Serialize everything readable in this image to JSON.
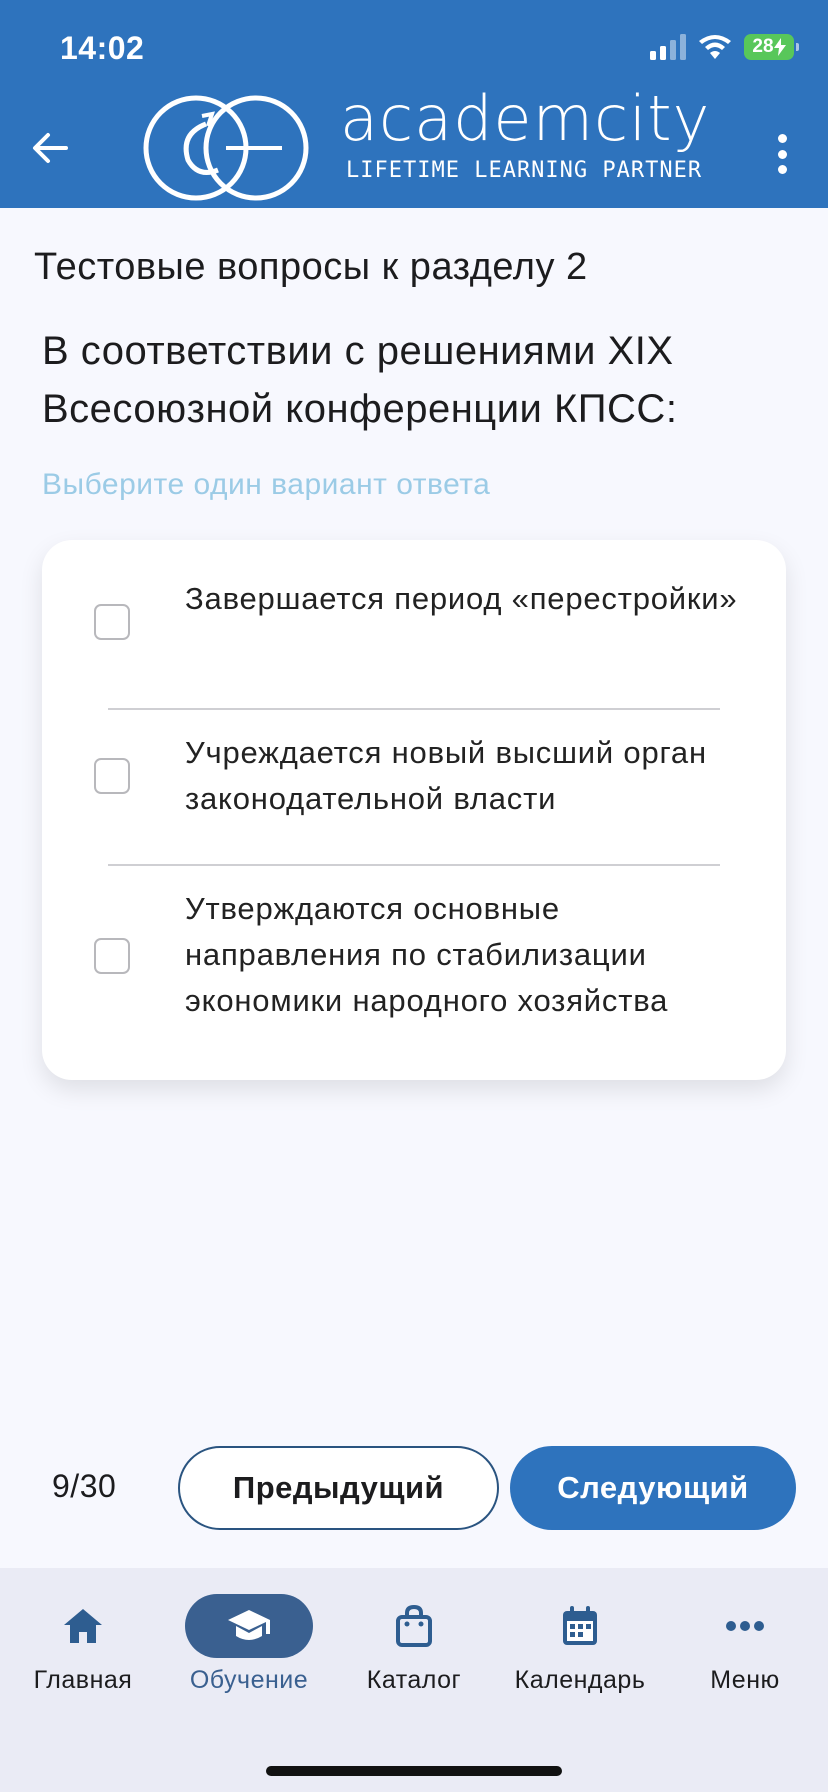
{
  "status_bar": {
    "time": "14:02",
    "battery": "28"
  },
  "header": {
    "brand_name": "academcity",
    "brand_tagline": "LIFETIME LEARNING PARTNER"
  },
  "page": {
    "section_title": "Тестовые вопросы к разделу 2",
    "question": "В соответствии с решениями XIX Всесоюзной конференции КПСС:",
    "hint": "Выберите один вариант ответа"
  },
  "options": [
    {
      "text": "Завершается период «перестройки»",
      "checked": false
    },
    {
      "text": "Учреждается новый высший орган законодательной власти",
      "checked": false
    },
    {
      "text": "Утверждаются основные направления по стабилизации экономики народного хозяйства",
      "checked": false
    }
  ],
  "pagination": {
    "counter": "9/30",
    "prev_label": "Предыдущий",
    "next_label": "Следующий"
  },
  "tabs": [
    {
      "label": "Главная",
      "icon": "home-icon",
      "active": false
    },
    {
      "label": "Обучение",
      "icon": "graduation-cap-icon",
      "active": true
    },
    {
      "label": "Каталог",
      "icon": "shopping-bag-icon",
      "active": false
    },
    {
      "label": "Календарь",
      "icon": "calendar-icon",
      "active": false
    },
    {
      "label": "Меню",
      "icon": "more-dots-icon",
      "active": false
    }
  ],
  "colors": {
    "primary": "#2e73bd",
    "active_tab": "#3a6090",
    "hint": "#9bcbe6",
    "battery": "#58c75a"
  }
}
